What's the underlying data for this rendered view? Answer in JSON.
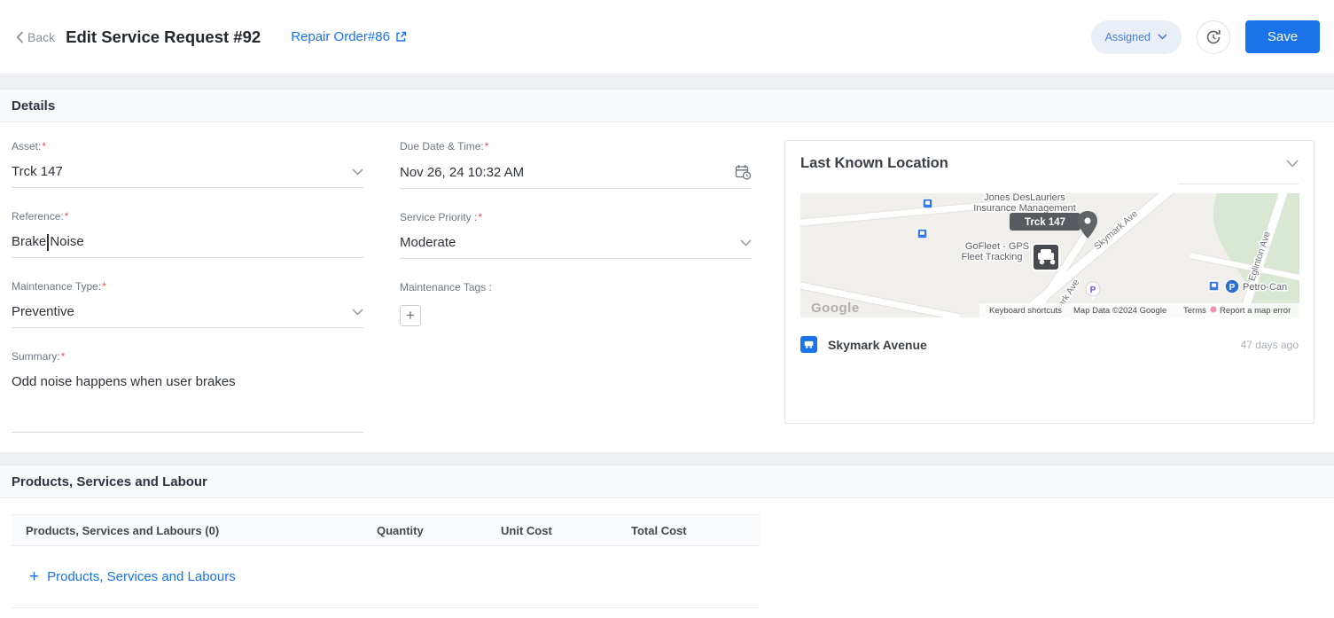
{
  "header": {
    "back": "Back",
    "title": "Edit Service Request #92",
    "repair_order": "Repair Order#86",
    "status": "Assigned",
    "save": "Save"
  },
  "details": {
    "title": "Details",
    "asset_label": "Asset:",
    "asset_required": "*",
    "asset_value": "Trck 147",
    "reference_label": "Reference:",
    "reference_required": "*",
    "reference_value": "Brake Noise",
    "maintenance_type_label": "Maintenance Type:",
    "maintenance_type_required": "*",
    "maintenance_type_value": "Preventive",
    "summary_label": "Summary:",
    "summary_required": "*",
    "summary_value": "Odd noise happens when user brakes",
    "due_label": "Due Date & Time:",
    "due_required": "*",
    "due_value": "Nov 26, 24 10:32 AM",
    "priority_label": "Service Priority :",
    "priority_required": "*",
    "priority_value": "Moderate",
    "tags_label": "Maintenance Tags :",
    "plus_icon": "+"
  },
  "location": {
    "title": "Last Known Location",
    "address": "Skymark Avenue",
    "ago": "47 days ago",
    "map": {
      "business1_line1": "Jones DesLauriers",
      "business1_line2": "Insurance Management",
      "business2_line1": "GoFleet - GPS",
      "business2_line2": "Fleet Tracking",
      "vehicle": "Trck 147",
      "street_skymark": "Skymark Ave",
      "street_skymark2": "mark Ave",
      "street_eglinton": "Eglinton Ave",
      "poi_parking": "P",
      "poi_petro_letter": "P",
      "poi_petro": "Petro-Can",
      "google": "Google",
      "attr_keyboard": "Keyboard shortcuts",
      "attr_data": "Map Data ©2024 Google",
      "attr_terms": "Terms",
      "attr_report": "Report a map error"
    }
  },
  "products": {
    "title": "Products, Services and Labour",
    "headers": [
      "Products, Services and Labours (0)",
      "Quantity",
      "Unit Cost",
      "Total Cost"
    ],
    "add_plus": "+",
    "add_label": "Products, Services and Labours"
  }
}
